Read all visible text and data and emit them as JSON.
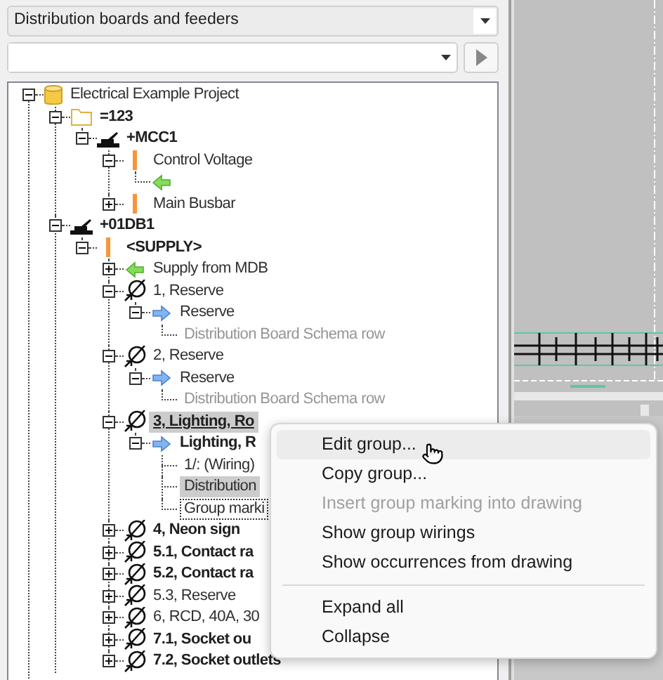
{
  "view_selector": {
    "value": "Distribution boards and feeders"
  },
  "tree": [
    {
      "label": "Electrical Example Project",
      "kind": "project",
      "in_drawing": false,
      "selected": false,
      "expanded": true,
      "children": [
        {
          "label": "=123",
          "kind": "function",
          "in_drawing": true,
          "selected": false,
          "expanded": true,
          "children": [
            {
              "label": "+MCC1",
              "kind": "location",
              "in_drawing": true,
              "selected": false,
              "expanded": true,
              "children": [
                {
                  "label": "Control Voltage",
                  "kind": "potential",
                  "in_drawing": false,
                  "selected": false,
                  "expanded": true,
                  "children": [
                    {
                      "kind": "supply",
                      "in_drawing": false,
                      "selected": false
                    }
                  ]
                },
                {
                  "label": "Main Busbar",
                  "kind": "potential",
                  "in_drawing": false,
                  "selected": false,
                  "expanded": false
                }
              ]
            }
          ]
        },
        {
          "label": "+01DB1",
          "kind": "location",
          "in_drawing": true,
          "selected": false,
          "expanded": true,
          "children": [
            {
              "label": "<SUPPLY>",
              "kind": "potential",
              "in_drawing": true,
              "selected": false,
              "expanded": true,
              "children": [
                {
                  "label": "Supply from MDB",
                  "kind": "supply",
                  "in_drawing": false,
                  "selected": false,
                  "expanded": false
                },
                {
                  "label": "1, Reserve",
                  "kind": "circuit",
                  "in_drawing": false,
                  "selected": false,
                  "expanded": true,
                  "children": [
                    {
                      "label": "Reserve",
                      "kind": "feeder",
                      "in_drawing": false,
                      "selected": false,
                      "expanded": true,
                      "children": [
                        {
                          "label": "Distribution Board Schema row",
                          "kind": "schema-row",
                          "in_drawing": false,
                          "selected": false
                        }
                      ]
                    }
                  ]
                },
                {
                  "label": "2, Reserve",
                  "kind": "circuit",
                  "in_drawing": false,
                  "selected": false,
                  "expanded": true,
                  "children": [
                    {
                      "label": "Reserve",
                      "kind": "feeder",
                      "in_drawing": false,
                      "selected": false,
                      "expanded": true,
                      "children": [
                        {
                          "label": "Distribution Board Schema row",
                          "kind": "schema-row",
                          "in_drawing": false,
                          "selected": false
                        }
                      ]
                    }
                  ]
                },
                {
                  "label": "3, Lighting, Ro",
                  "kind": "circuit",
                  "in_drawing": true,
                  "selected": true,
                  "hovered": true,
                  "expanded": true,
                  "children": [
                    {
                      "label": "Lighting, R",
                      "kind": "feeder",
                      "in_drawing": true,
                      "selected": false,
                      "expanded": true,
                      "children": [
                        {
                          "label": "1/: (Wiring)",
                          "kind": "row",
                          "in_drawing": false,
                          "selected": false
                        },
                        {
                          "label": "Distribution",
                          "kind": "row",
                          "in_drawing": false,
                          "selected": true
                        },
                        {
                          "label": "Group marki",
                          "kind": "row",
                          "in_drawing": false,
                          "selected": false,
                          "focused": true
                        }
                      ]
                    }
                  ]
                },
                {
                  "label": "4, Neon sign",
                  "kind": "circuit",
                  "in_drawing": true,
                  "selected": false,
                  "expanded": false
                },
                {
                  "label": "5.1, Contact ra",
                  "kind": "circuit",
                  "in_drawing": true,
                  "selected": false,
                  "expanded": false
                },
                {
                  "label": "5.2, Contact ra",
                  "kind": "circuit",
                  "in_drawing": true,
                  "selected": false,
                  "expanded": false
                },
                {
                  "label": "5.3, Reserve",
                  "kind": "circuit",
                  "in_drawing": false,
                  "selected": false,
                  "expanded": false
                },
                {
                  "label": "6, RCD, 40A, 30",
                  "kind": "circuit",
                  "in_drawing": false,
                  "selected": false,
                  "expanded": false
                },
                {
                  "label": "7.1, Socket ou",
                  "kind": "circuit",
                  "in_drawing": true,
                  "selected": false,
                  "expanded": false
                },
                {
                  "label": "7.2, Socket outlets",
                  "kind": "circuit",
                  "in_drawing": true,
                  "selected": false,
                  "expanded": false
                }
              ]
            }
          ]
        }
      ]
    }
  ],
  "context_menu": [
    {
      "kind": "item",
      "label": "Edit group...",
      "disabled": false,
      "selected": true
    },
    {
      "kind": "item",
      "label": "Copy group...",
      "disabled": false,
      "selected": false
    },
    {
      "kind": "item",
      "label": "Insert group marking into drawing",
      "disabled": true,
      "selected": false
    },
    {
      "kind": "item",
      "label": "Show group wirings",
      "disabled": false,
      "selected": false
    },
    {
      "kind": "item",
      "label": "Show occurrences from drawing",
      "disabled": false,
      "selected": false
    },
    {
      "kind": "separator"
    },
    {
      "kind": "item",
      "label": "Expand all",
      "disabled": false,
      "selected": false
    },
    {
      "kind": "item",
      "label": "Collapse",
      "disabled": false,
      "selected": false
    }
  ]
}
